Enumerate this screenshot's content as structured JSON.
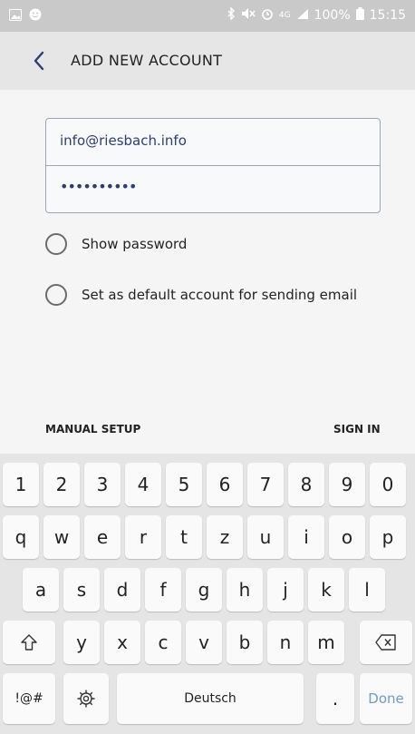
{
  "status_bar": {
    "left_icons": [
      "image-icon",
      "smile-icon"
    ],
    "right_icons": [
      "bluetooth-icon",
      "mute-icon",
      "alarm-icon",
      "signal-icon"
    ],
    "network": "4G",
    "battery": "100%",
    "time": "15:15"
  },
  "appbar": {
    "title": "ADD NEW ACCOUNT"
  },
  "form": {
    "email": "info@riesbach.info",
    "password": "••••••••••"
  },
  "options": [
    {
      "label": "Show password",
      "checked": false
    },
    {
      "label": "Set as default account for sending email",
      "checked": false
    }
  ],
  "actions": {
    "manual_setup": "MANUAL SETUP",
    "sign_in": "SIGN IN"
  },
  "keyboard": {
    "row1": [
      "1",
      "2",
      "3",
      "4",
      "5",
      "6",
      "7",
      "8",
      "9",
      "0"
    ],
    "row2": [
      "q",
      "w",
      "e",
      "r",
      "t",
      "z",
      "u",
      "i",
      "o",
      "p"
    ],
    "row3": [
      "a",
      "s",
      "d",
      "f",
      "g",
      "h",
      "j",
      "k",
      "l"
    ],
    "row4": [
      "y",
      "x",
      "c",
      "v",
      "b",
      "n",
      "m"
    ],
    "symbols": "!@#",
    "space": "Deutsch",
    "period": ".",
    "done": "Done"
  },
  "colors": {
    "accent": "#2e3e6e",
    "done": "#6f9bc7"
  }
}
